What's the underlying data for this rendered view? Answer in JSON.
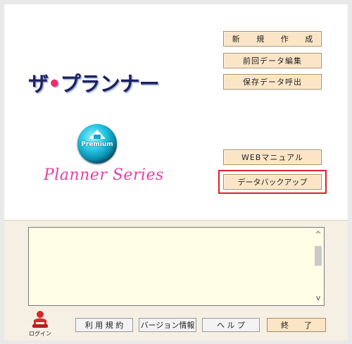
{
  "logo": {
    "title_part1": "ザ",
    "title_dot": "•",
    "title_part2": "プランナー",
    "emblem_text": "Premium",
    "series": "Planner Series"
  },
  "buttons": {
    "new": "新 規 作 成",
    "edit": "前回データ編集",
    "load": "保存データ呼出",
    "manual": "WEBマニュアル",
    "backup": "データバックアップ"
  },
  "textarea": {
    "scroll_up": "^",
    "scroll_down": "v"
  },
  "footer": {
    "login_label": "ログイン",
    "terms": "利 用 規 約",
    "version": "バージョン情報",
    "help": "ヘ ル プ",
    "exit": "終　　了"
  },
  "colors": {
    "highlight": "#d8232a",
    "button_bg": "#fbe5c6",
    "text_area_bg": "#ffffe6"
  },
  "icons": [
    "up-arrow-icon",
    "login-person-icon"
  ]
}
